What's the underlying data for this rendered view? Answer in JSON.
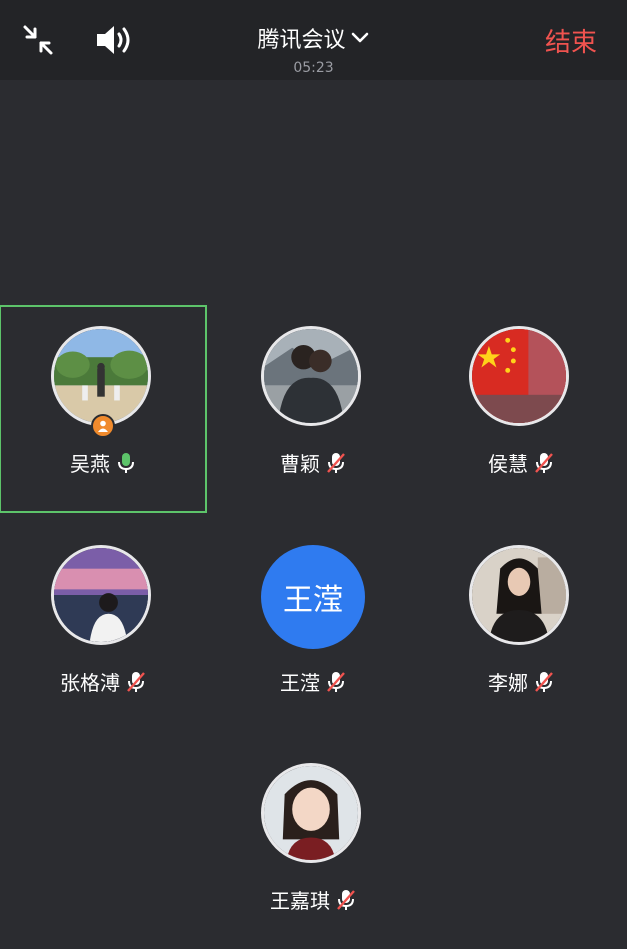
{
  "header": {
    "title": "腾讯会议",
    "timer": "05:23",
    "end_label": "结束",
    "icons": {
      "minimize": "minimize-icon",
      "speaker": "speaker-icon",
      "dropdown": "chevron-down-icon"
    }
  },
  "participants": [
    {
      "name": "吴燕",
      "avatar": "photo-family",
      "mic": "on",
      "host": true,
      "active": true
    },
    {
      "name": "曹颖",
      "avatar": "photo-couple",
      "mic": "muted"
    },
    {
      "name": "侯慧",
      "avatar": "photo-flag",
      "mic": "muted"
    },
    {
      "name": "张格溥",
      "avatar": "photo-sunset",
      "mic": "muted"
    },
    {
      "name": "王滢",
      "avatar_text": "王滢",
      "mic": "muted"
    },
    {
      "name": "李娜",
      "avatar": "photo-woman",
      "mic": "muted"
    },
    {
      "name": "王嘉琪",
      "avatar": "photo-child",
      "mic": "muted"
    }
  ],
  "colors": {
    "background": "#2b2c30",
    "topbar": "#232427",
    "end": "#f0534f",
    "active_border": "#5dc46a",
    "mic_on": "#5dc46a",
    "mic_muted_slash": "#f0534f",
    "text_avatar": "#2f7bf0",
    "host_badge": "#f08a2c"
  }
}
